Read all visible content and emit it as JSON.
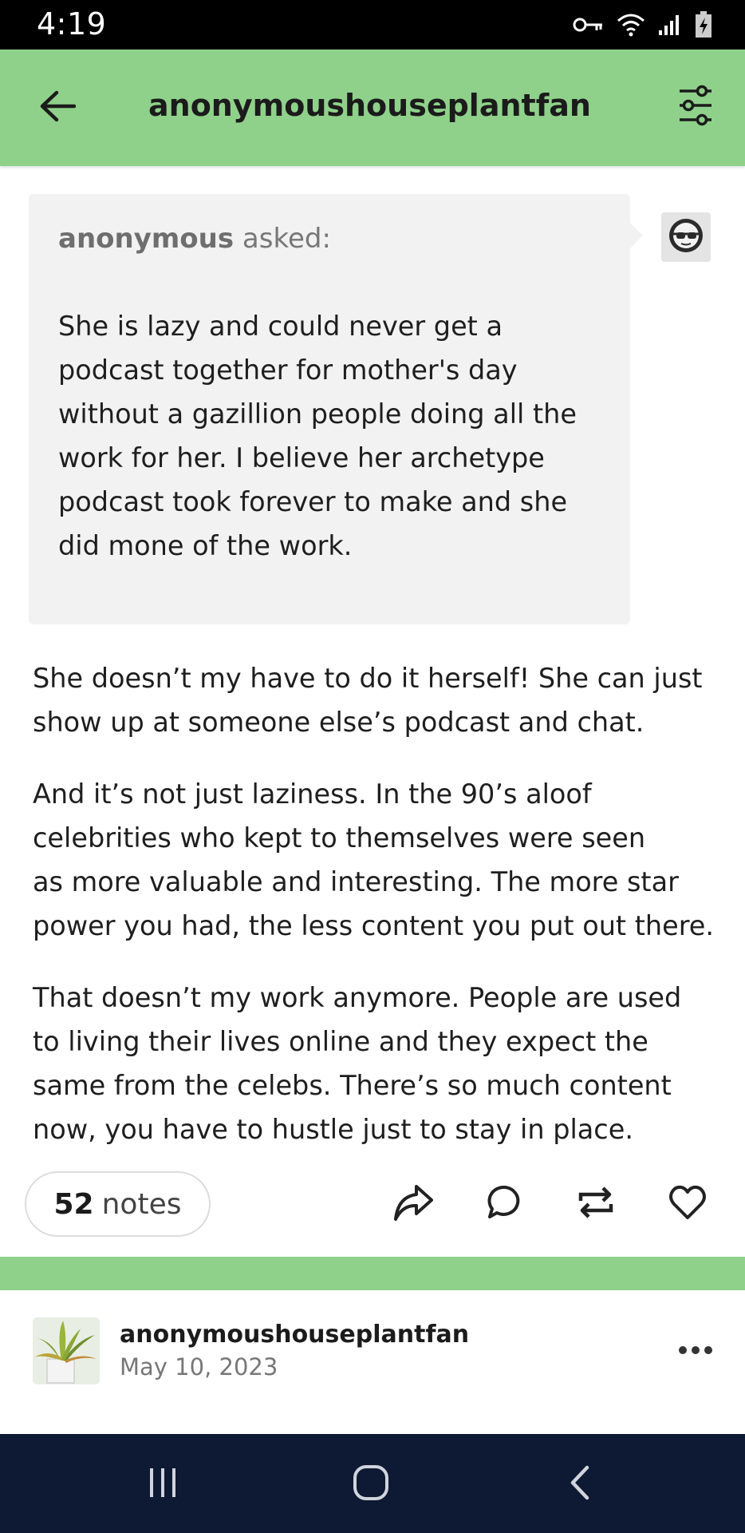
{
  "status_bar": {
    "time": "4:19",
    "icons": [
      "key-icon",
      "wifi-icon",
      "signal-icon",
      "battery-charging-icon"
    ]
  },
  "top_bar": {
    "title": "anonymoushouseplantfan",
    "back_icon": "arrow-left-icon",
    "filter_icon": "sliders-icon"
  },
  "ask": {
    "asker": "anonymous",
    "verb": "asked:",
    "lines": [
      "She is lazy and could never get a",
      "podcast together for mother's day",
      "without a gazillion people doing all the",
      "work for her.  I believe her archetype",
      "podcast took forever to make and she",
      "did mone of the work."
    ],
    "avatar_icon": "anonymous-sunglasses-icon"
  },
  "answer": {
    "p1": [
      "She doesn’t my have to do it herself! She can just",
      "show up at someone else’s podcast and chat."
    ],
    "p2": [
      "And it’s not just laziness. In the 90’s aloof",
      "celebrities who kept to themselves were seen",
      "as more valuable and interesting. The more star",
      "power you had, the less content you put out there."
    ],
    "p3": [
      "That doesn’t my work anymore. People are used",
      "to living their lives online and they expect the",
      "same from the celebs. There’s so much content",
      "now, you have to hustle just to stay in place."
    ]
  },
  "actions": {
    "notes_count": "52",
    "notes_label": "notes",
    "icons": [
      "share-icon",
      "comment-icon",
      "reblog-icon",
      "heart-icon"
    ]
  },
  "post_footer": {
    "username": "anonymoushouseplantfan",
    "date": "May 10, 2023",
    "more_icon": "ellipsis-icon"
  },
  "nav": {
    "icons": [
      "recent-apps-icon",
      "home-icon",
      "back-icon"
    ]
  },
  "colors": {
    "accent_green": "#8fd18a",
    "nav_bg": "#0e1a33",
    "ask_bg": "#f2f2f2"
  }
}
